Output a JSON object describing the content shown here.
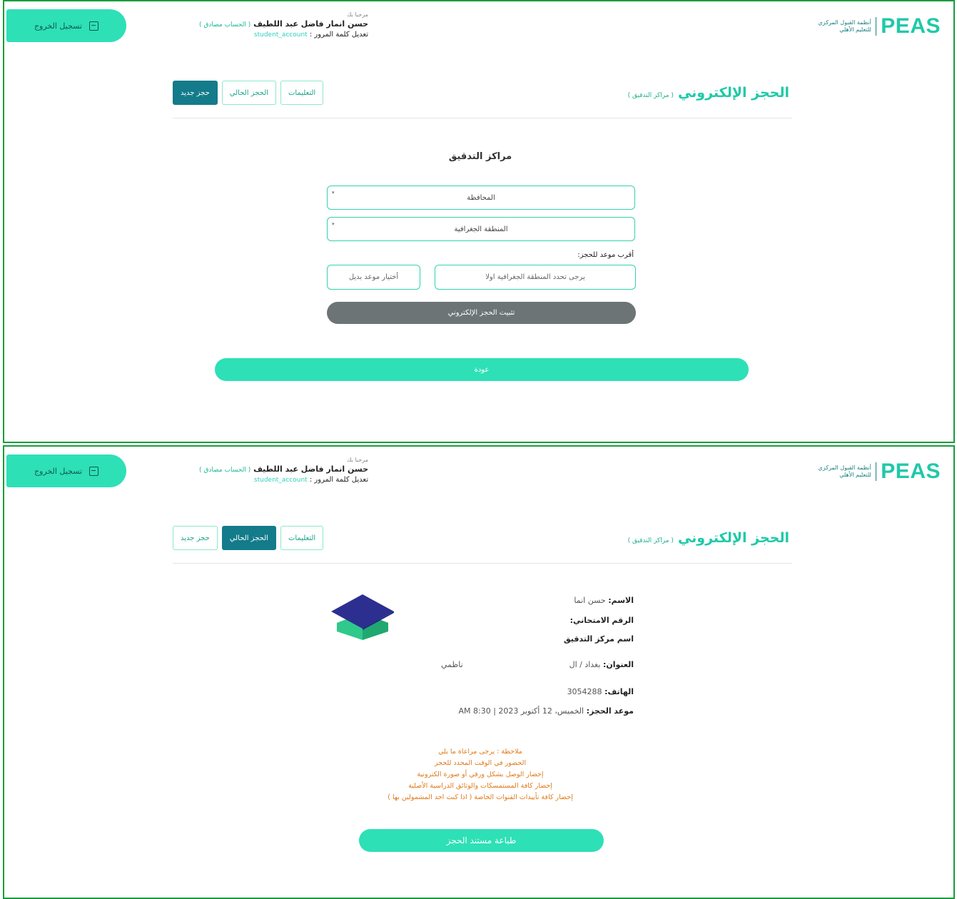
{
  "header": {
    "logout_label": "تسجيل الخروج",
    "welcome": "مرحبا بك",
    "user_name": "حسن انمار فاضل عبد اللطيف",
    "trusted_label": "( الحساب مصادق )",
    "change_password": "تعديل كلمة المرور :",
    "account_type": "student_account",
    "logo_text": "PEAS",
    "logo_sub_line1": "أنظمة القبول المركزي",
    "logo_sub_line2": "للتعليم الأهلي"
  },
  "page": {
    "title": "الحجز الإلكتروني",
    "subtitle": "( مراكز التدقيق )",
    "tabs": {
      "instructions": "التعليمات",
      "current": "الحجز الحالي",
      "new": "حجز جديد"
    }
  },
  "booking_form": {
    "section_title": "مراكز التدقيق",
    "governorate_placeholder": "المحافظة",
    "region_placeholder": "المنطقة الجغرافية",
    "nearest_label": "أقرب موعد للحجز:",
    "date_hint": "يرجى تحدد المنطقة الجغرافية اولا",
    "alt_button": "أختيار موعد بديل",
    "confirm_button": "تثبيت الحجز الإلكتروني",
    "back_button": "عودة"
  },
  "current_booking": {
    "name_label": "الاسم:",
    "name_value": "حسن انما",
    "exam_no_label": "الرقم الامتحاني:",
    "center_name_label": "اسم مركز التدقيق",
    "address_label": "العنوان:",
    "address_value": "بغداد / ال",
    "address_extra": "ناظمي",
    "phone_label": "الهاتف:",
    "phone_value": "3054288",
    "date_label": "موعد الحجز:",
    "date_value": "الخميس، 12 أكتوبر 2023",
    "time_value": "8:30 AM",
    "notes": [
      "ملاحظة : يرجى مراعاة ما يلي",
      "الحضور في الوقت المحدد للحجز",
      "إحضار الوصل بشكل ورقي أو صورة الكترونية",
      "إحضار كافة المستمسكات والوثائق الدراسية الأصلية",
      "إحضار كافة تأييدات القنوات الخاصة ( اذا كنت احد المشمولين بها )"
    ],
    "print_button": "طباعة مستند الحجز"
  },
  "colors": {
    "accent": "#2ee0b6",
    "brand": "#1fc9a8",
    "active_tab": "#137b8a",
    "frame_border": "#1a9c3c",
    "note_text": "#e07a1a",
    "disabled_button": "#6c7476"
  },
  "icons": [
    "logout-icon",
    "graduation-cap-icon",
    "dropdown-caret-icon"
  ]
}
